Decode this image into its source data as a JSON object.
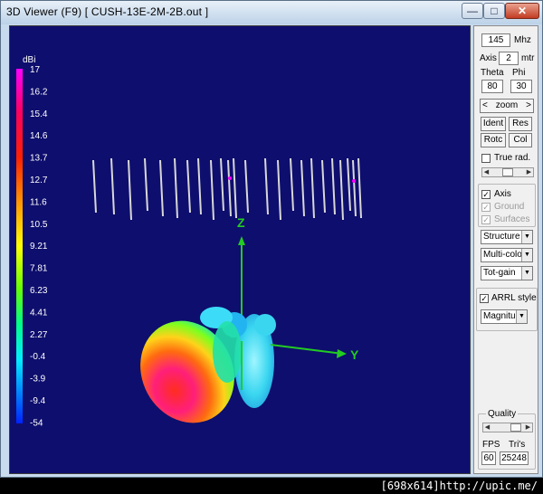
{
  "window": {
    "title": "3D Viewer (F9)    [  CUSH-13E-2M-2B.out ]",
    "min_glyph": "—",
    "max_glyph": "□",
    "close_glyph": "✕"
  },
  "legend": {
    "unit": "dBi",
    "ticks": [
      "17",
      "16.2",
      "15.4",
      "14.6",
      "13.7",
      "12.7",
      "11.6",
      "10.5",
      "9.21",
      "7.81",
      "6.23",
      "4.41",
      "2.27",
      "-0.4",
      "-3.9",
      "-9.4",
      "-54"
    ]
  },
  "axes": {
    "z_label": "Z",
    "y_label": "Y",
    "axis_color": "#22cc22"
  },
  "panel": {
    "freq_value": "145",
    "freq_unit": "Mhz",
    "axis_label": "Axis",
    "axis_value": "2",
    "axis_unit": "mtr",
    "theta_label": "Theta",
    "phi_label": "Phi",
    "theta_value": "80",
    "phi_value": "30",
    "zoom_left": "<",
    "zoom_label": "zoom",
    "zoom_right": ">",
    "ident_label": "Ident",
    "res_label": "Res",
    "rotc_label": "Rotc",
    "col_label": "Col",
    "true_rad_label": "True rad.",
    "axis_check_label": "Axis",
    "ground_label": "Ground",
    "surfaces_label": "Surfaces",
    "structure_combo": "Structure",
    "color_combo": "Multi-colo",
    "gain_combo": "Tot-gain",
    "arrl_label": "ARRL style",
    "magnitude_combo": "Magnitu",
    "quality_label": "Quality",
    "fps_label": "FPS",
    "tris_label": "Tri's",
    "fps_value": "60",
    "tris_value": "25248",
    "check_glyph": "✓"
  },
  "statusbar": {
    "text": "[698x614]http://upic.me/"
  }
}
